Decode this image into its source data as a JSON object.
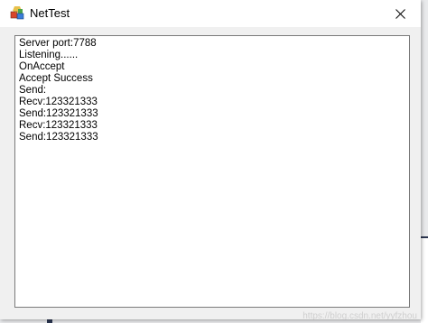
{
  "window": {
    "title": "NetTest",
    "close_glyph": "close-icon",
    "app_icon": "app-icon"
  },
  "log": {
    "lines": [
      "Server port:7788",
      "Listening......",
      "OnAccept",
      "Accept Success",
      "Send:",
      "Recv:123321333",
      "Send:123321333",
      "Recv:123321333",
      "Send:123321333"
    ]
  },
  "watermark": "https://blog.csdn.net/yyfzhou",
  "colors": {
    "titlebar": "#ffffff",
    "window_bg": "#f0f0f0",
    "log_bg": "#ffffff",
    "log_border": "#7a7a7a"
  }
}
